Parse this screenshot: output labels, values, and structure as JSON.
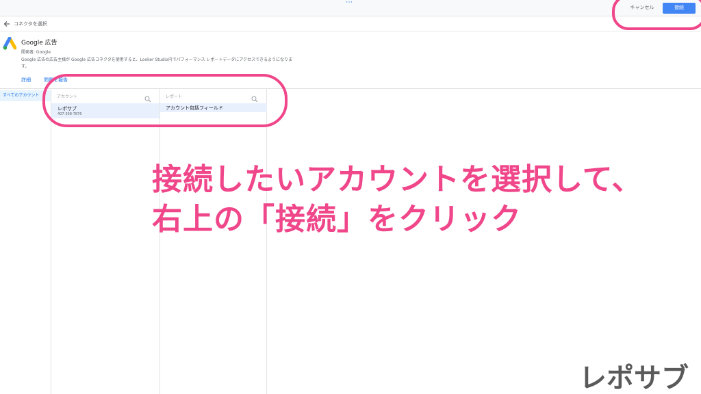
{
  "topbar": {
    "dots": "⋯",
    "cancel_label": "キャンセル",
    "connect_label": "接続"
  },
  "nav": {
    "back_label": "コネクタを選択"
  },
  "connector": {
    "title": "Google 広告",
    "developer": "開発者: Google",
    "description": "Google 広告の広告主様が Google 広告コネクタを使用すると、Looker Studio内でパフォーマンス レポートデータにアクセスできるようになります。",
    "link_details": "詳細",
    "link_second": "問題を報告"
  },
  "sidebar": {
    "items": [
      {
        "label": "すべてのアカウント"
      }
    ]
  },
  "columns": {
    "account": {
      "placeholder": "アカウント",
      "rows": [
        {
          "name": "レポサブ",
          "id": "407-308-7876"
        }
      ]
    },
    "report": {
      "placeholder": "レポート",
      "rows": [
        {
          "name": "アカウント包括フィールド"
        }
      ]
    }
  },
  "annotation": {
    "line1": "接続したいアカウントを選択して、",
    "line2": "右上の「接続」をクリック"
  },
  "brand": "レポサブ",
  "colors": {
    "accent": "#4285f4",
    "annotation": "#f0468a"
  }
}
